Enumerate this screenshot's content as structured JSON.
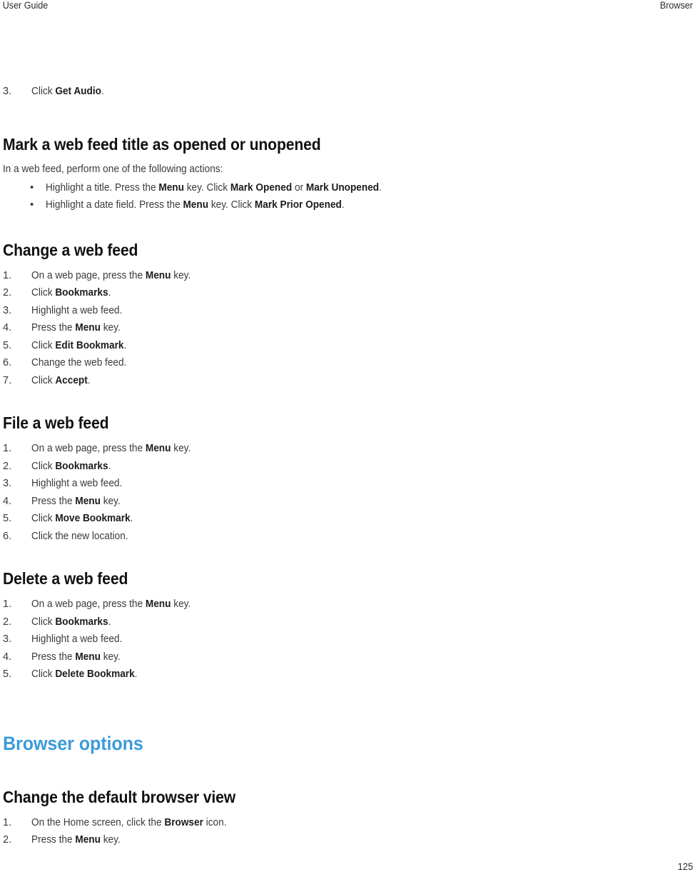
{
  "page": {
    "running_head_left": "User Guide",
    "running_head_right": "Browser",
    "page_number": "125",
    "accent_color": "#3c9bdb",
    "body_color": "#3a3a3a",
    "heading_color": "#111111"
  },
  "continued_step": {
    "marker": "3.",
    "prefix": "Click ",
    "bold": "Get Audio",
    "suffix": "."
  },
  "sections": [
    {
      "id": "mark-web-feed-title",
      "heading": "Mark a web feed title as opened or unopened",
      "intro": "In a web feed, perform one of the following actions:",
      "list_type": "bullets",
      "items": [
        {
          "marker": "•",
          "parts": [
            {
              "t": "Highlight a title. Press the ",
              "b": false
            },
            {
              "t": "Menu",
              "b": true
            },
            {
              "t": " key. Click ",
              "b": false
            },
            {
              "t": "Mark Opened",
              "b": true
            },
            {
              "t": " or ",
              "b": false
            },
            {
              "t": "Mark Unopened",
              "b": true
            },
            {
              "t": ".",
              "b": false
            }
          ]
        },
        {
          "marker": "•",
          "parts": [
            {
              "t": "Highlight a date field. Press the ",
              "b": false
            },
            {
              "t": "Menu",
              "b": true
            },
            {
              "t": " key. Click ",
              "b": false
            },
            {
              "t": "Mark Prior Opened",
              "b": true
            },
            {
              "t": ".",
              "b": false
            }
          ]
        }
      ]
    },
    {
      "id": "change-a-web-feed",
      "heading": "Change a web feed",
      "list_type": "steps",
      "items": [
        {
          "marker": "1.",
          "parts": [
            {
              "t": "On a web page, press the ",
              "b": false
            },
            {
              "t": "Menu",
              "b": true
            },
            {
              "t": " key.",
              "b": false
            }
          ]
        },
        {
          "marker": "2.",
          "parts": [
            {
              "t": "Click ",
              "b": false
            },
            {
              "t": "Bookmarks",
              "b": true
            },
            {
              "t": ".",
              "b": false
            }
          ]
        },
        {
          "marker": "3.",
          "parts": [
            {
              "t": "Highlight a web feed.",
              "b": false
            }
          ]
        },
        {
          "marker": "4.",
          "parts": [
            {
              "t": "Press the ",
              "b": false
            },
            {
              "t": "Menu",
              "b": true
            },
            {
              "t": " key.",
              "b": false
            }
          ]
        },
        {
          "marker": "5.",
          "parts": [
            {
              "t": "Click ",
              "b": false
            },
            {
              "t": "Edit Bookmark",
              "b": true
            },
            {
              "t": ".",
              "b": false
            }
          ]
        },
        {
          "marker": "6.",
          "parts": [
            {
              "t": "Change the web feed.",
              "b": false
            }
          ]
        },
        {
          "marker": "7.",
          "parts": [
            {
              "t": "Click ",
              "b": false
            },
            {
              "t": "Accept",
              "b": true
            },
            {
              "t": ".",
              "b": false
            }
          ]
        }
      ]
    },
    {
      "id": "file-a-web-feed",
      "heading": "File a web feed",
      "list_type": "steps",
      "items": [
        {
          "marker": "1.",
          "parts": [
            {
              "t": "On a web page, press the ",
              "b": false
            },
            {
              "t": "Menu",
              "b": true
            },
            {
              "t": " key.",
              "b": false
            }
          ]
        },
        {
          "marker": "2.",
          "parts": [
            {
              "t": "Click ",
              "b": false
            },
            {
              "t": "Bookmarks",
              "b": true
            },
            {
              "t": ".",
              "b": false
            }
          ]
        },
        {
          "marker": "3.",
          "parts": [
            {
              "t": "Highlight a web feed.",
              "b": false
            }
          ]
        },
        {
          "marker": "4.",
          "parts": [
            {
              "t": "Press the ",
              "b": false
            },
            {
              "t": "Menu",
              "b": true
            },
            {
              "t": " key.",
              "b": false
            }
          ]
        },
        {
          "marker": "5.",
          "parts": [
            {
              "t": "Click ",
              "b": false
            },
            {
              "t": "Move Bookmark",
              "b": true
            },
            {
              "t": ".",
              "b": false
            }
          ]
        },
        {
          "marker": "6.",
          "parts": [
            {
              "t": "Click the new location.",
              "b": false
            }
          ]
        }
      ]
    },
    {
      "id": "delete-a-web-feed",
      "heading": "Delete a web feed",
      "list_type": "steps",
      "items": [
        {
          "marker": "1.",
          "parts": [
            {
              "t": "On a web page, press the ",
              "b": false
            },
            {
              "t": "Menu",
              "b": true
            },
            {
              "t": " key.",
              "b": false
            }
          ]
        },
        {
          "marker": "2.",
          "parts": [
            {
              "t": "Click ",
              "b": false
            },
            {
              "t": "Bookmarks",
              "b": true
            },
            {
              "t": ".",
              "b": false
            }
          ]
        },
        {
          "marker": "3.",
          "parts": [
            {
              "t": "Highlight a web feed.",
              "b": false
            }
          ]
        },
        {
          "marker": "4.",
          "parts": [
            {
              "t": "Press the ",
              "b": false
            },
            {
              "t": "Menu",
              "b": true
            },
            {
              "t": " key.",
              "b": false
            }
          ]
        },
        {
          "marker": "5.",
          "parts": [
            {
              "t": "Click ",
              "b": false
            },
            {
              "t": "Delete Bookmark",
              "b": true
            },
            {
              "t": ".",
              "b": false
            }
          ]
        }
      ]
    }
  ],
  "chapter": {
    "title": "Browser options"
  },
  "sections_after_chapter": [
    {
      "id": "change-default-browser-view",
      "heading": "Change the default browser view",
      "list_type": "steps",
      "items": [
        {
          "marker": "1.",
          "parts": [
            {
              "t": "On the Home screen, click the ",
              "b": false
            },
            {
              "t": "Browser",
              "b": true
            },
            {
              "t": " icon.",
              "b": false
            }
          ]
        },
        {
          "marker": "2.",
          "parts": [
            {
              "t": "Press the ",
              "b": false
            },
            {
              "t": "Menu",
              "b": true
            },
            {
              "t": " key.",
              "b": false
            }
          ]
        }
      ]
    }
  ]
}
